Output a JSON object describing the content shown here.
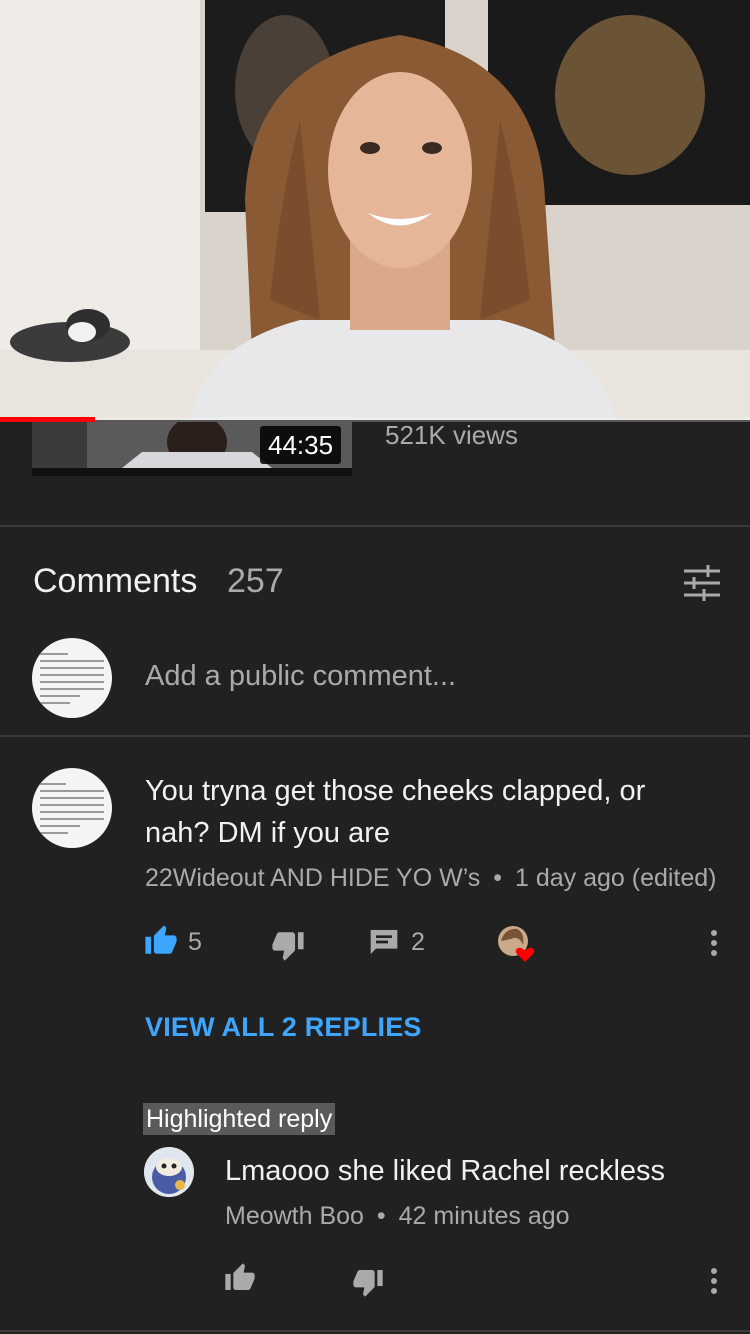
{
  "player": {
    "progress_fraction": 0.127
  },
  "related": {
    "duration": "44:35",
    "views": "521K views"
  },
  "comments": {
    "title": "Comments",
    "count": "257",
    "sort_icon": "sort-filter-icon",
    "add_placeholder": "Add a public comment..."
  },
  "comment": {
    "text_line1": "You tryna get those cheeks clapped, or",
    "text_line2": "nah? DM if you are",
    "author": "22Wideout AND HIDE YO W’s",
    "separator": "•",
    "time": "1 day ago (edited)",
    "likes": "5",
    "replies": "2",
    "icons": {
      "like": "thumbs-up-icon",
      "dislike": "thumbs-down-icon",
      "reply": "reply-icon",
      "heart": "creator-heart-icon",
      "more": "more-vert-icon"
    },
    "view_replies": "VIEW ALL 2 REPLIES"
  },
  "highlighted_reply": {
    "badge": "Highlighted reply",
    "text": "Lmaooo she liked Rachel reckless",
    "author": "Meowth Boo",
    "separator": "•",
    "time": "42 minutes ago"
  },
  "colors": {
    "background": "#212121",
    "accent_blue": "#3ea6ff",
    "progress_red": "#ff0000",
    "heart_red": "#ff0000"
  }
}
